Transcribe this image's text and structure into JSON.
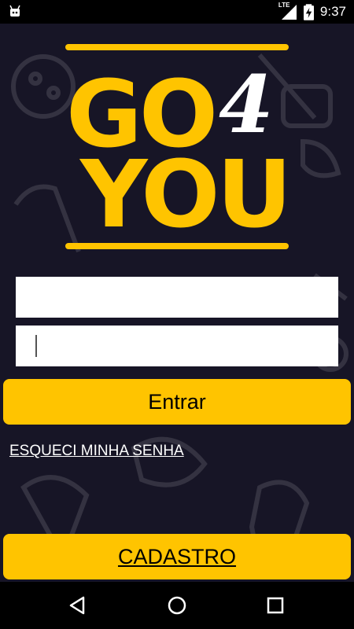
{
  "status_bar": {
    "time": "9:37",
    "network": "LTE",
    "icons": [
      "android-notification-icon",
      "lte-signal-icon",
      "battery-charging-icon"
    ]
  },
  "logo": {
    "line1": "GO",
    "accent": "4",
    "line2": "YOU"
  },
  "form": {
    "username_value": "",
    "password_value": ""
  },
  "buttons": {
    "login_label": "Entrar",
    "forgot_label": "ESQUECI MINHA SENHA",
    "signup_label": "CADASTRO"
  },
  "nav_bar": {
    "icons": [
      "back-icon",
      "home-icon",
      "recents-icon"
    ]
  },
  "colors": {
    "background": "#171526",
    "accent": "#FFC400",
    "text_light": "#FFFFFF"
  }
}
